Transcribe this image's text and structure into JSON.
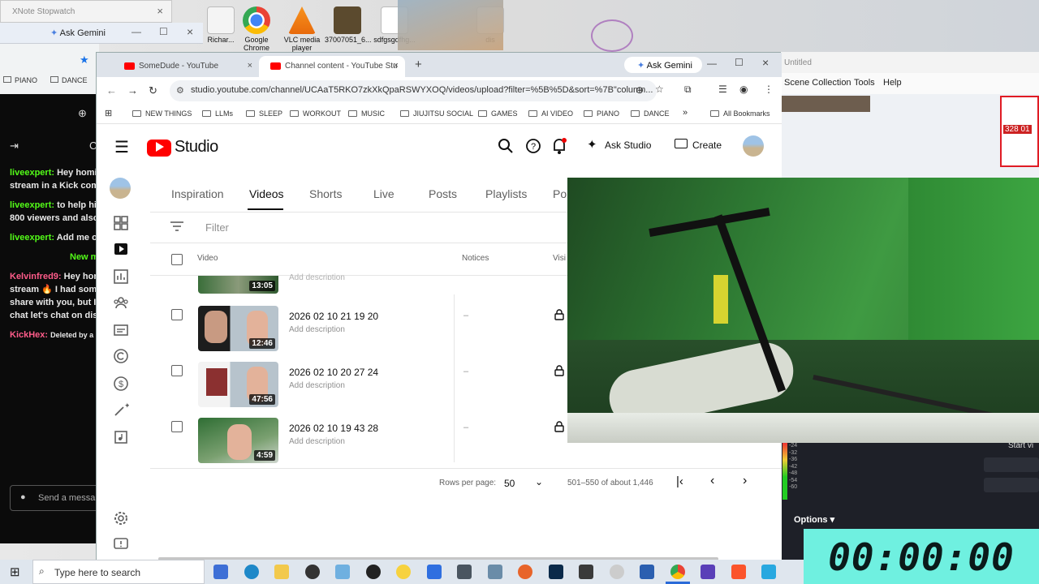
{
  "desktop": {
    "icons": [
      {
        "label": "Richar..."
      },
      {
        "label": "Google Chrome"
      },
      {
        "label": "VLC media player"
      },
      {
        "label": "37007051_6..."
      },
      {
        "label": "sdfgsgdfhg..."
      },
      {
        "label": "dis"
      }
    ]
  },
  "xnote": {
    "title": "XNote Stopwatch",
    "close": "×"
  },
  "gemini_small": {
    "label": "Ask Gemini",
    "min": "—",
    "max": "☐",
    "close": "×"
  },
  "left_bookmarks": [
    "PIANO",
    "DANCE"
  ],
  "chat": {
    "messages": [
      {
        "user": "liveexpert:",
        "text": "Hey homi",
        "line2": "stream in a Kick comm"
      },
      {
        "user": "liveexpert:",
        "text": "to help hi",
        "line2": "800 viewers and also"
      },
      {
        "user": "liveexpert:",
        "text": "Add me o"
      },
      {
        "user": "",
        "text": "New m"
      },
      {
        "user": "Kelvinfred9:",
        "text": "Hey hon",
        "line2": "stream 🔥 I had some",
        "line3": "share with you, but I",
        "line4": "chat let's chat on disc"
      },
      {
        "user": "KickHex:",
        "text": "Deleted by a"
      }
    ],
    "send_placeholder": "Send a messa"
  },
  "browser": {
    "tabs": [
      {
        "title": "SomeDude - YouTube",
        "close": "×"
      },
      {
        "title": "Channel content - YouTube Stu",
        "close": "×"
      }
    ],
    "new_tab": "+",
    "ask_gemini": "Ask Gemini",
    "url": "studio.youtube.com/channel/UCAaT5RKO7zkXkQpaRSWYXOQ/videos/upload?filter=%5B%5D&sort=%7B\"column...",
    "bookmarks": [
      "NEW THINGS",
      "LLMs",
      "SLEEP",
      "WORKOUT",
      "MUSIC",
      "JIUJITSU SOCIAL",
      "GAMES",
      "AI VIDEO",
      "PIANO",
      "DANCE"
    ],
    "all_bookmarks": "All Bookmarks",
    "more": "»"
  },
  "studio": {
    "logo_text": "Studio",
    "ask_studio": "Ask Studio",
    "create": "Create",
    "tabs": [
      "Inspiration",
      "Videos",
      "Shorts",
      "Live",
      "Posts",
      "Playlists",
      "Po"
    ],
    "active_tab": "Videos",
    "filter_placeholder": "Filter",
    "columns": {
      "video": "Video",
      "notices": "Notices",
      "visibility": "Visi"
    },
    "partial_row": {
      "duration": "13:05",
      "desc": "Add description"
    },
    "rows": [
      {
        "title": "2026 02 10 21 19 20",
        "desc": "Add description",
        "duration": "12:46",
        "notices": "–"
      },
      {
        "title": "2026 02 10 20 27 24",
        "desc": "Add description",
        "duration": "47:56",
        "notices": "–"
      },
      {
        "title": "2026 02 10 19 43 28",
        "desc": "Add description",
        "duration": "4:59",
        "notices": "–"
      }
    ],
    "pagination": {
      "rows_per_page_label": "Rows per page:",
      "rows_per_page": "50",
      "range": "501–550 of about 1,446"
    }
  },
  "obs": {
    "title": "Untitled",
    "menu": [
      "Scene Collection",
      "Tools",
      "Help"
    ],
    "options": "Options",
    "meter": [
      "-24",
      "-32",
      "-36",
      "-42",
      "-48",
      "-54",
      "-60"
    ],
    "start": "Start vi",
    "fps": "328 01"
  },
  "stopwatch": {
    "time": "00:00:00"
  },
  "taskbar": {
    "search_placeholder": "Type here to search"
  },
  "colors": {
    "youtube_red": "#ff0000",
    "kick_green": "#53fc18",
    "stopwatch_bg": "#6ff0e0"
  }
}
